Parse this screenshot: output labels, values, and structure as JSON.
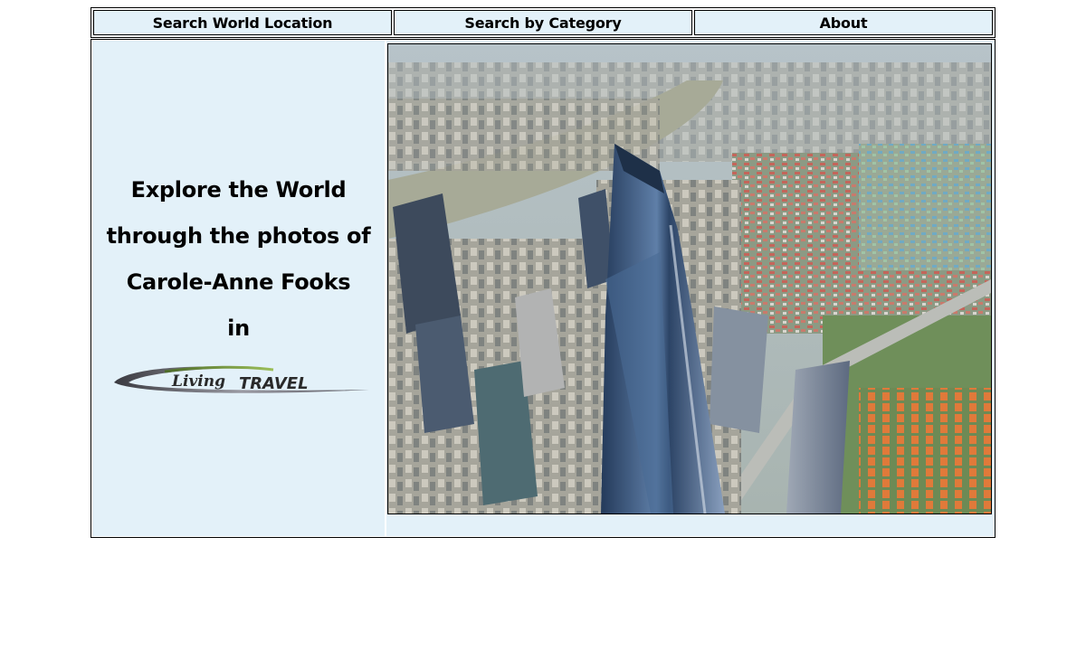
{
  "nav": {
    "items": [
      {
        "label": "Search World Location"
      },
      {
        "label": "Search by Category"
      },
      {
        "label": "About"
      }
    ]
  },
  "intro": {
    "line1": "Explore the World",
    "line2": "through the photos of",
    "line3": "Carole-Anne Fooks",
    "line4": "in"
  },
  "logo": {
    "text_script": "Living",
    "text_caps": "TRAVEL"
  },
  "colors": {
    "panel_bg": "#e3f1f9",
    "border": "#000000"
  }
}
